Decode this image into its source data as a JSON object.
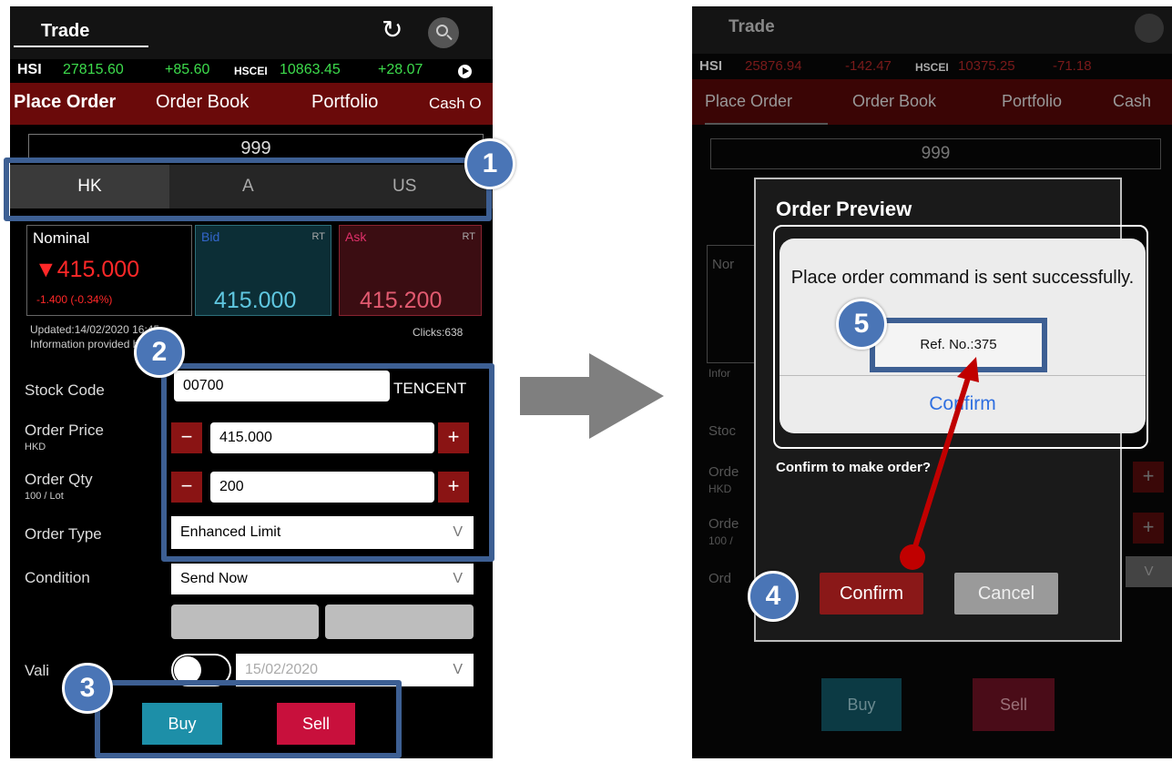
{
  "left": {
    "title": "Trade",
    "ticker": {
      "hsi_label": "HSI",
      "hsi_value": "27815.60",
      "hsi_change": "+85.60",
      "hscei_label": "HSCEI",
      "hscei_value": "10863.45",
      "hscei_change": "+28.07"
    },
    "tabs": [
      "Place Order",
      "Order Book",
      "Portfolio",
      "Cash O"
    ],
    "search_value": "999",
    "markets": [
      "HK",
      "A",
      "US"
    ],
    "quote": {
      "nominal_label": "Nominal",
      "nominal_value": "▼415.000",
      "nominal_change": "-1.400  (-0.34%)",
      "bid_label": "Bid",
      "bid_rt": "RT",
      "bid_value": "415.000",
      "ask_label": "Ask",
      "ask_rt": "RT",
      "ask_value": "415.200",
      "updated": "Updated:14/02/2020 16:45",
      "info": "Information provided by ETNet",
      "clicks": "Clicks:638"
    },
    "form": {
      "stock_code_label": "Stock Code",
      "stock_code_value": "00700",
      "stock_name": "TENCENT",
      "order_price_label": "Order Price",
      "order_price_sub": "HKD",
      "order_price_value": "415.000",
      "order_qty_label": "Order Qty",
      "order_qty_sub": "100 / Lot",
      "order_qty_value": "200",
      "order_type_label": "Order Type",
      "order_type_value": "Enhanced Limit",
      "condition_label": "Condition",
      "condition_value": "Send Now",
      "validity_label": "Vali",
      "validity_date": "15/02/2020",
      "minus": "−",
      "plus": "+",
      "chevron": "V"
    },
    "buy": "Buy",
    "sell": "Sell"
  },
  "right": {
    "title": "Trade",
    "ticker": {
      "hsi_label": "HSI",
      "hsi_value": "25876.94",
      "hsi_change": "-142.47",
      "hscei_label": "HSCEI",
      "hscei_value": "10375.25",
      "hscei_change": "-71.18"
    },
    "tabs": [
      "Place Order",
      "Order Book",
      "Portfolio",
      "Cash"
    ],
    "search_value": "999",
    "bg_labels": {
      "nominal": "Nor",
      "stock": "Stoc",
      "order1": "Orde",
      "hkd": "HKD",
      "order2": "Orde",
      "lot": "100 /",
      "ord": "Ord",
      "info": "Infor",
      "chevron": "V",
      "plus": "+"
    },
    "preview": {
      "title": "Order Preview",
      "question": "Confirm to make order?",
      "confirm": "Confirm",
      "cancel": "Cancel"
    },
    "alert": {
      "message": "Place order command is sent successfully.",
      "ref": "Ref. No.:375",
      "confirm": "Confirm"
    },
    "buy": "Buy",
    "sell": "Sell"
  },
  "annotations": [
    "1",
    "2",
    "3",
    "4",
    "5"
  ],
  "colors": {
    "annotation_blue": "#3d5f93",
    "badge_blue": "#4a75b6",
    "arrow_red": "#c00000",
    "arrow_grey": "#7f7f7f"
  }
}
